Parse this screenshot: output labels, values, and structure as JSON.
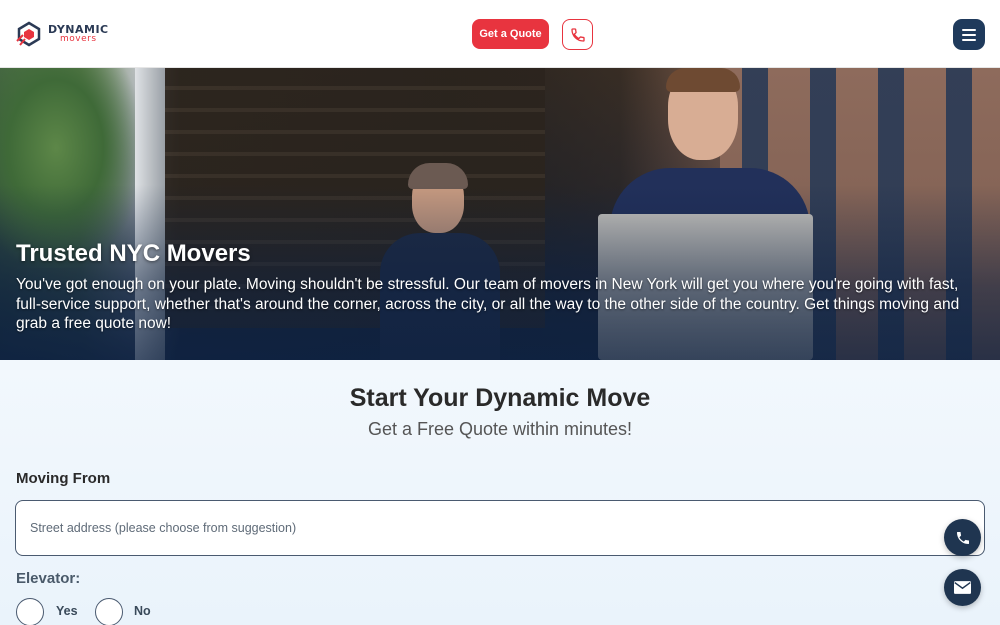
{
  "header": {
    "logo_line1": "DYNAMIC",
    "logo_line2": "movers",
    "quote_label": "Get a Quote",
    "brand_color": "#e8343f",
    "nav_color": "#1f3a5c"
  },
  "hero": {
    "title": "Trusted NYC Movers",
    "text": "You've got enough on your plate. Moving shouldn't be stressful. Our team of movers in New York will get you where you're going with fast, full-service support, whether that's around the corner, across the city, or all the way to the other side of the country. Get things moving and grab a free quote now!"
  },
  "form": {
    "title": "Start Your Dynamic Move",
    "subtitle": "Get a Free Quote within minutes!",
    "moving_from_label": "Moving From",
    "address_placeholder": "Street address (please choose from suggestion)",
    "elevator_label": "Elevator:",
    "option_yes": "Yes",
    "option_no": "No"
  },
  "icons": {
    "phone": "phone-icon",
    "menu": "hamburger-menu-icon",
    "mail": "envelope-icon"
  }
}
